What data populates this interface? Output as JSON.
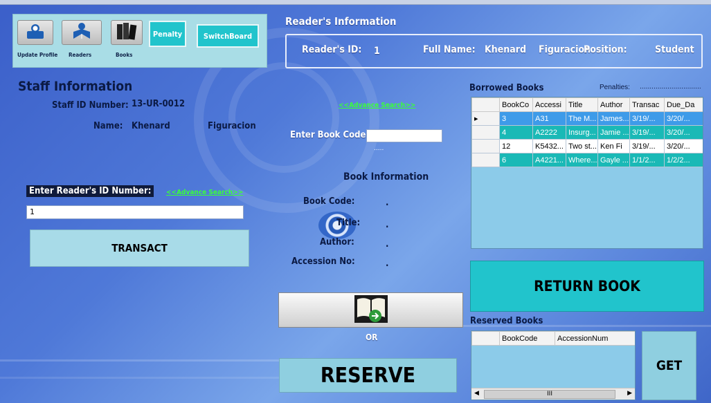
{
  "toolbar": {
    "update_profile": "Update Profile",
    "readers": "Readers",
    "books": "Books",
    "penalty": "Penalty",
    "switchboard": "SwitchBoard"
  },
  "reader_info": {
    "heading": "Reader's Information",
    "id_label": "Reader's ID:",
    "id_value": "1",
    "fullname_label": "Full Name:",
    "first_name": "Khenard",
    "last_name": "Figuracion",
    "position_label": "Position:",
    "position_value": "Student"
  },
  "staff": {
    "heading": "Staff Information",
    "id_label": "Staff ID Number:",
    "id_value": "13-UR-0012",
    "name_label": "Name:",
    "first_name": "Khenard",
    "last_name": "Figuracion"
  },
  "reader_search": {
    "label": "Enter Reader's ID Number:",
    "advance": "<<Advance Search>>",
    "value": "1",
    "transact": "TRANSACT"
  },
  "book_search": {
    "advance": "<<Advance Search>>",
    "code_label": "Enter Book Code:",
    "code_value": "",
    "dots": "....."
  },
  "book_info": {
    "heading": "Book Information",
    "code_label": "Book Code:",
    "code_value": ".",
    "title_label": "Title:",
    "title_value": ".",
    "author_label": "Author:",
    "author_value": ".",
    "accession_label": "Accession No:",
    "accession_value": "."
  },
  "borrow": {
    "or": "OR",
    "reserve": "RESERVE"
  },
  "borrowed": {
    "heading": "Borrowed Books",
    "penalties_label": "Penalties:",
    "penalties_value": "...............................",
    "columns": [
      "BookCo",
      "Accessi",
      "Title",
      "Author",
      "Transac",
      "Due_Da"
    ],
    "rows": [
      [
        "3",
        "A31",
        "The M...",
        "James...",
        "3/19/...",
        "3/20/..."
      ],
      [
        "4",
        "A2222",
        "Insurg...",
        "Jamie ...",
        "3/19/...",
        "3/20/..."
      ],
      [
        "12",
        "K5432...",
        "Two st...",
        "Ken Fi",
        "3/19/...",
        "3/20/..."
      ],
      [
        "6",
        "A4221...",
        "Where...",
        "Gayle ...",
        "1/1/2...",
        "1/2/2..."
      ]
    ],
    "return_book": "RETURN BOOK"
  },
  "reserved": {
    "heading": "Reserved Books",
    "columns": [
      "BookCode",
      "AccessionNum"
    ],
    "scroll_mark": "III",
    "get": "GET"
  },
  "colors": {
    "toolbar_bg": "#a9dde6",
    "teal": "#21c4cc",
    "light_button": "#a8dbe8",
    "grid_bg": "#8ccbe9",
    "link_green": "#39ff3a"
  }
}
